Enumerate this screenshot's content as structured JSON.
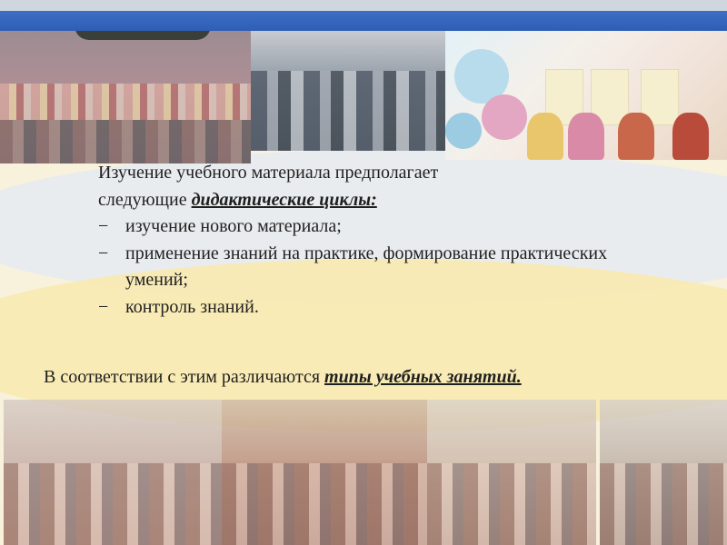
{
  "slide": {
    "intro": {
      "line1": "Изучение учебного материала предполагает",
      "line2_prefix": "следующие ",
      "line2_emphasis": "дидактические циклы:"
    },
    "items": [
      "изучение нового материала;",
      "применение знаний на практике, формирование практических умений;",
      "контроль знаний."
    ],
    "footer": {
      "prefix": "В соответствии с этим различаются ",
      "emphasis": "типы учебных занятий."
    }
  },
  "colors": {
    "blue_band": "#2f5db5",
    "background": "#f8f2dd",
    "text": "#1f1f1f"
  }
}
